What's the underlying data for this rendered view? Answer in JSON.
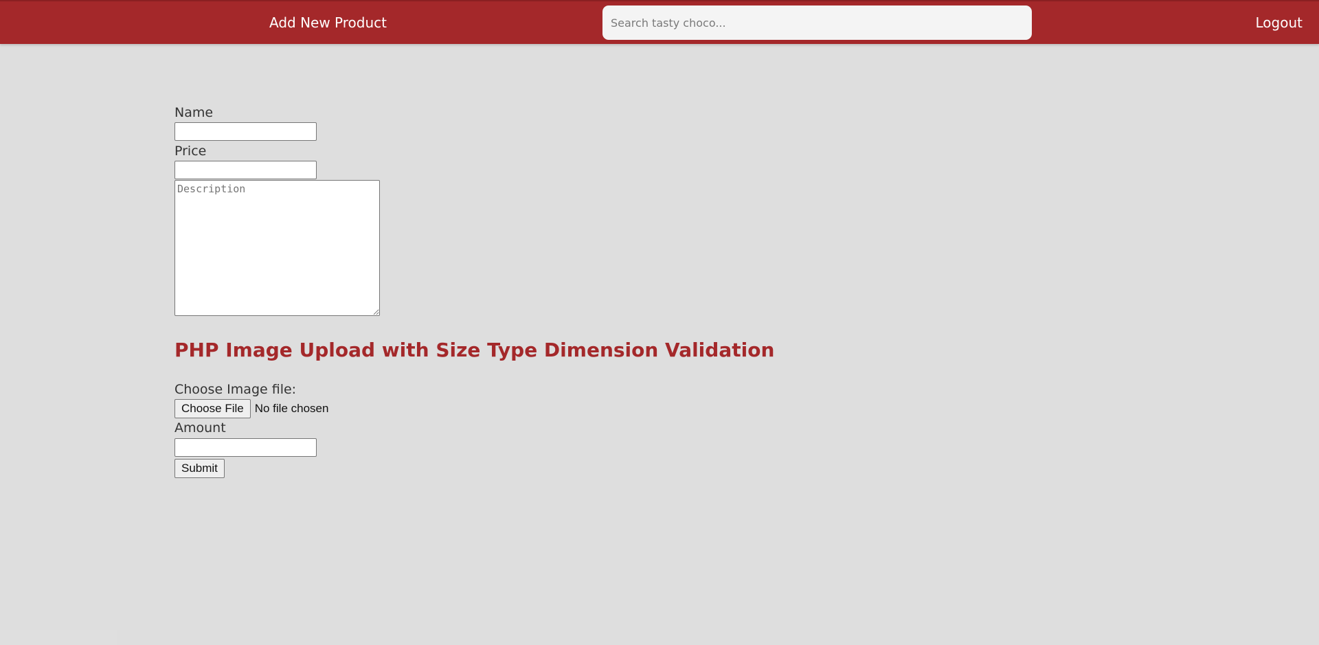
{
  "navbar": {
    "add_product_label": "Add New Product",
    "search_placeholder": "Search tasty choco...",
    "logout_label": "Logout"
  },
  "form": {
    "name_label": "Name",
    "price_label": "Price",
    "description_placeholder": "Description",
    "heading": "PHP Image Upload with Size Type Dimension Validation",
    "image_label": "Choose Image file:",
    "choose_file_label": "Choose File",
    "file_status": "No file chosen",
    "amount_label": "Amount",
    "submit_label": "Submit"
  },
  "colors": {
    "brand": "#a4282a",
    "background": "#dedede"
  }
}
